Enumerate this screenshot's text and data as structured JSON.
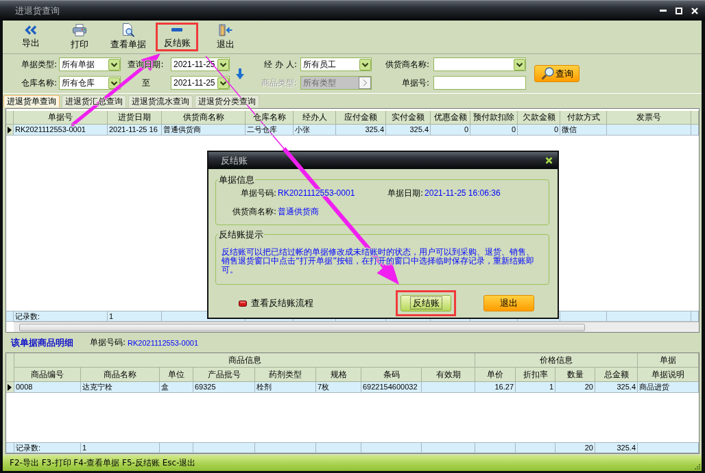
{
  "window": {
    "title": "进退货查询"
  },
  "toolbar": [
    {
      "kind": "export",
      "label": "导出",
      "highlighted": false
    },
    {
      "kind": "print",
      "label": "打印",
      "highlighted": false
    },
    {
      "kind": "view",
      "label": "查看单据",
      "highlighted": false
    },
    {
      "kind": "unpost",
      "label": "反结账",
      "highlighted": true
    },
    {
      "kind": "exit",
      "label": "退出",
      "highlighted": false
    }
  ],
  "filters": {
    "rows": [
      [
        {
          "label": "单据类型:",
          "kind": "select",
          "value": "所有单据",
          "disabled": false
        },
        {
          "label": "查询日期:",
          "kind": "date",
          "value": "2021-11-25",
          "disabled": false
        },
        {
          "label": "经 办 人:",
          "kind": "select",
          "value": "所有员工",
          "disabled": false
        },
        {
          "label": "供货商名称:",
          "kind": "select",
          "disabled": false
        }
      ],
      [
        {
          "label": "仓库名称:",
          "kind": "select",
          "value": "所有仓库",
          "disabled": false
        },
        {
          "label": "至",
          "kind": "date",
          "value": "2021-11-25",
          "disabled": false
        },
        {
          "label": "商品类型:",
          "kind": "picker",
          "value": "所有类型",
          "disabled": true
        },
        {
          "label": "单据号:",
          "kind": "input",
          "disabled": false
        }
      ]
    ],
    "search_button": {
      "label": "查询"
    }
  },
  "tabs": [
    {
      "label": "进退货单查询",
      "selected": true
    },
    {
      "label": "进退货汇总查询",
      "selected": false
    },
    {
      "label": "进退货流水查询",
      "selected": false
    },
    {
      "label": "进退货分类查询",
      "selected": false
    }
  ],
  "orders_table": {
    "columns": [
      {
        "label": "单据号",
        "kind": "text",
        "footer": "记录数:"
      },
      {
        "label": "进货日期",
        "kind": "text",
        "footer": "1"
      },
      {
        "label": "供货商名称",
        "kind": "text"
      },
      {
        "label": "仓库名称",
        "kind": "text"
      },
      {
        "label": "经办人",
        "kind": "text"
      },
      {
        "label": "应付金额",
        "kind": "number"
      },
      {
        "label": "实付金额",
        "kind": "number"
      },
      {
        "label": "优惠金额",
        "kind": "number"
      },
      {
        "label": "预付款扣除",
        "kind": "number"
      },
      {
        "label": "欠款金额",
        "kind": "number"
      },
      {
        "label": "付款方式",
        "kind": "text"
      },
      {
        "label": "发票号",
        "kind": "text"
      }
    ],
    "rows": [
      {
        "selected": true,
        "cells": [
          "RK2021112553-0001",
          "2021-11-25 16",
          "普通供货商",
          "二号仓库",
          "小张",
          "325.4",
          "325.4",
          "0",
          "0",
          "0",
          "微信"
        ]
      }
    ]
  },
  "detail_header": {
    "title": "该单据商品明细",
    "order_no_label": "单据号码:",
    "order_no": "RK2021112553-0001"
  },
  "detail_table": {
    "column_groups": [
      {
        "label": "商品信息",
        "columns": [
          {
            "label": "商品编号",
            "kind": "text",
            "footer": "记录数:"
          },
          {
            "label": "商品名称",
            "kind": "text",
            "footer": "1"
          },
          {
            "label": "单位",
            "kind": "text"
          },
          {
            "label": "产品批号",
            "kind": "text"
          },
          {
            "label": "药剂类型",
            "kind": "text"
          },
          {
            "label": "规格",
            "kind": "text"
          },
          {
            "label": "条码",
            "kind": "text"
          },
          {
            "label": "有效期",
            "kind": "text"
          }
        ]
      },
      {
        "label": "价格信息",
        "columns": [
          {
            "label": "单价",
            "kind": "number"
          },
          {
            "label": "折扣率",
            "kind": "number"
          },
          {
            "label": "数量",
            "kind": "number",
            "footer": "20"
          },
          {
            "label": "总金额",
            "kind": "number",
            "footer": "325.4"
          }
        ]
      },
      {
        "label": "单据",
        "columns": [
          {
            "label": "单据说明",
            "kind": "text"
          }
        ]
      }
    ],
    "rows": [
      {
        "selected": true,
        "cells": [
          [
            "0008",
            "达克宁栓",
            "盒",
            "69325",
            "栓剂",
            "7枚",
            "6922154600032"
          ],
          [
            "16.27",
            "1",
            "20",
            "325.4"
          ],
          [
            "商品进货"
          ]
        ]
      }
    ]
  },
  "status_bar": "F2-导出 F3-打印 F4-查看单据 F5-反结账 Esc-退出",
  "dialog": {
    "title": "反结账",
    "info": {
      "title": "单据信息",
      "fields": [
        {
          "label": "单据号码:",
          "value": "RK2021112553-0001"
        },
        {
          "label": "单据日期:",
          "value": "2021-11-25 16:06:36"
        },
        {
          "label": "供货商名称:",
          "value": "普通供货商"
        }
      ]
    },
    "note": {
      "title": "反结账提示",
      "text": "反结账可以把已结过帐的单据修改成未结账时的状态，用户可以到采购、退货、销售、销售退货窗口中点击“打开单据”按钮，在打开的窗口中选择临时保存记录，重新结账即可。"
    },
    "link": "查看反结账流程",
    "buttons": [
      {
        "kind": "confirm",
        "label": "反结账",
        "highlighted": true,
        "focused": true
      },
      {
        "kind": "cancel",
        "label": "退出",
        "highlighted": false,
        "focused": false
      }
    ]
  }
}
